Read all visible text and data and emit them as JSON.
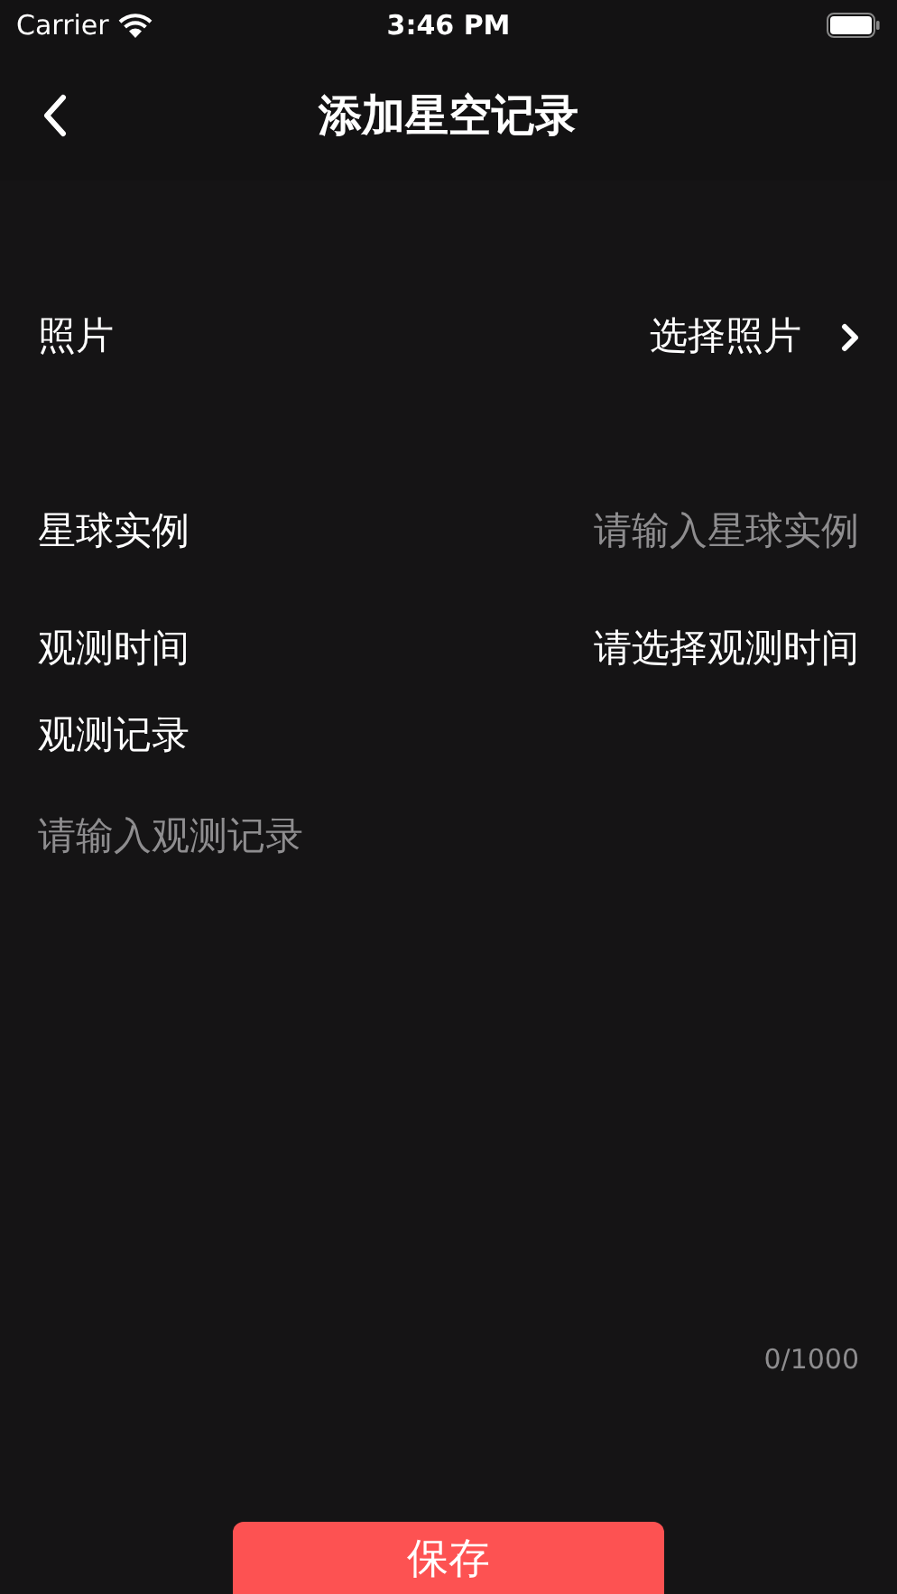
{
  "status_bar": {
    "carrier": "Carrier",
    "time": "3:46 PM"
  },
  "nav": {
    "title": "添加星空记录"
  },
  "photo_row": {
    "label": "照片",
    "action": "选择照片"
  },
  "fields": [
    {
      "kind": "input",
      "label": "星球实例",
      "placeholder": "请输入星球实例"
    },
    {
      "kind": "picker",
      "label": "观测时间",
      "prompt": "请选择观测时间"
    }
  ],
  "notes": {
    "label": "观测记录",
    "placeholder": "请输入观测记录",
    "counter": "0/1000"
  },
  "save_button": "保存"
}
